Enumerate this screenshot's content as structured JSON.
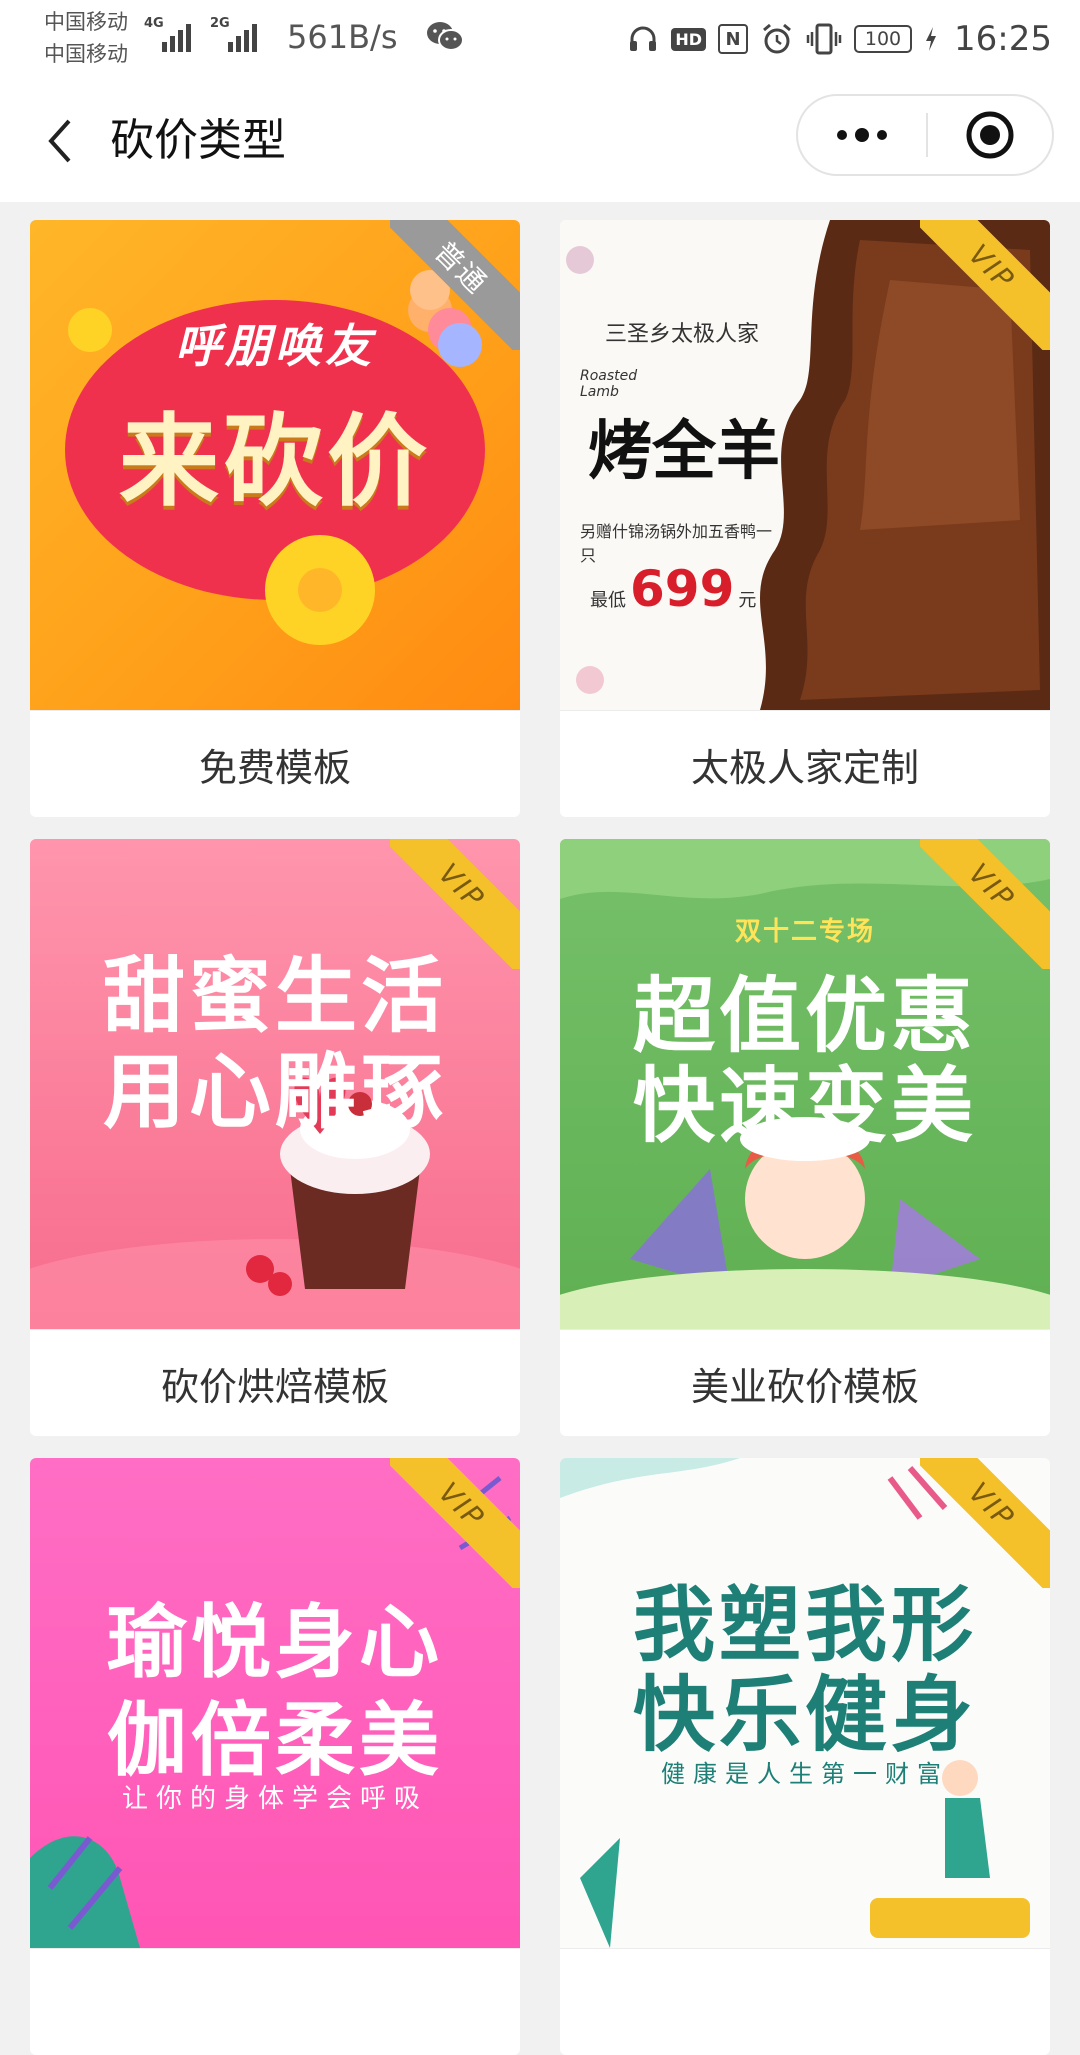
{
  "status": {
    "carrier1": "中国移动",
    "carrier2": "中国移动",
    "net1": "4G",
    "net2": "2G",
    "speed": "561B/s",
    "hd": "HD",
    "nfc": "N",
    "battery": "100",
    "time": "16:25"
  },
  "nav": {
    "title": "砍价类型"
  },
  "cards": [
    {
      "label": "免费模板",
      "badge": "普通",
      "line1": "呼朋唤友",
      "line2": "来砍价"
    },
    {
      "label": "太极人家定制",
      "badge": "VIP",
      "brand": "三圣乡太极人家",
      "en": "Roasted Lamb",
      "dish": "烤全羊",
      "promo": "另赠什锦汤锅外加五香鸭一只",
      "price_prefix": "最低",
      "price": "699",
      "price_unit": "元"
    },
    {
      "label": "砍价烘焙模板",
      "badge": "VIP",
      "line1": "甜蜜生活",
      "line2": "用心雕琢"
    },
    {
      "label": "美业砍价模板",
      "badge": "VIP",
      "top": "双十二专场",
      "line1": "超值优惠",
      "line2": "快速变美"
    },
    {
      "label": "",
      "badge": "VIP",
      "line1": "瑜悦身心",
      "line2": "伽倍柔美",
      "sub": "让你的身体学会呼吸"
    },
    {
      "label": "",
      "badge": "VIP",
      "line1": "我塑我形",
      "line2": "快乐健身",
      "sub": "健康是人生第一财富"
    }
  ]
}
